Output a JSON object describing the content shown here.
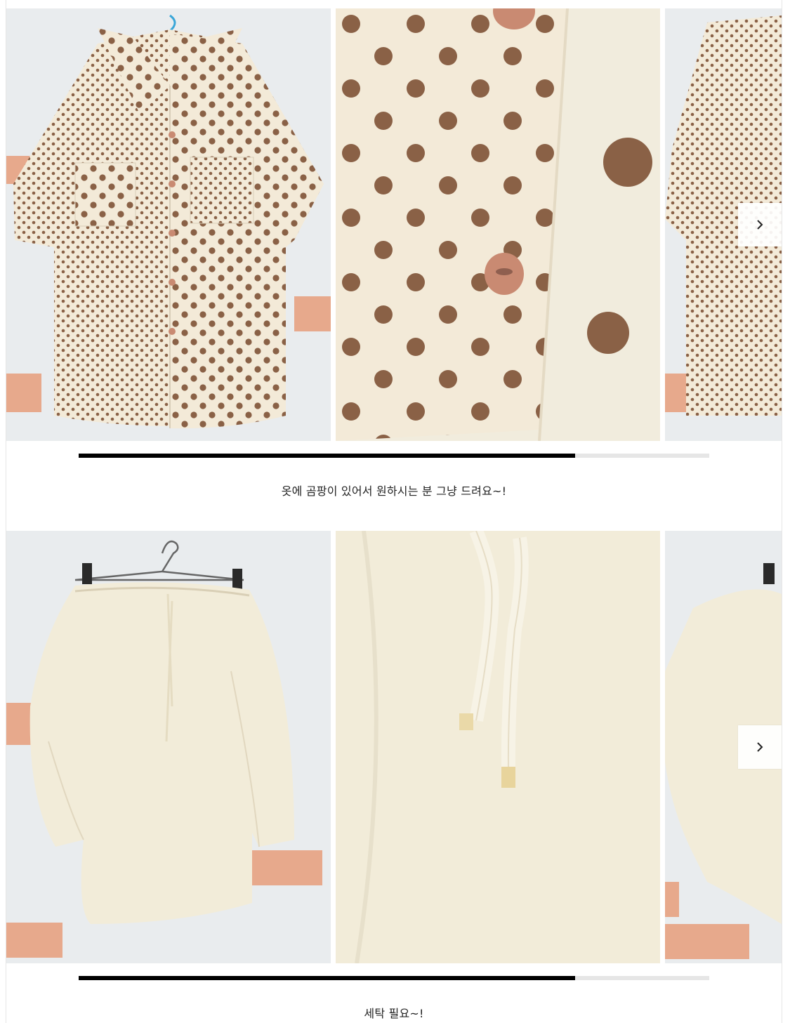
{
  "colors": {
    "progress_fill": "#000000",
    "progress_track": "#e6e6e6",
    "polka_fabric": "#f3ead8",
    "polka_dot": "#8a6146",
    "button": "#c98a72",
    "cream_fabric": "#f2ecd9",
    "wall": "#e9ecee",
    "brick": "#e7a98c"
  },
  "sections": [
    {
      "slides": [
        {
          "subject": "polka dot shirt full view"
        },
        {
          "subject": "polka dot shirt button close-up"
        },
        {
          "subject": "polka dot shirt back view"
        }
      ],
      "next_icon": "chevron-right-icon",
      "progress": 0.787,
      "caption": "옷에 곰팡이 있어서 원하시는 분 그냥 드려요~!"
    },
    {
      "slides": [
        {
          "subject": "cream blouse on hanger"
        },
        {
          "subject": "cream blouse drawstring close-up"
        },
        {
          "subject": "cream blouse side view"
        }
      ],
      "next_icon": "chevron-right-icon",
      "progress": 0.787,
      "caption": "세탁 필요~!"
    }
  ]
}
